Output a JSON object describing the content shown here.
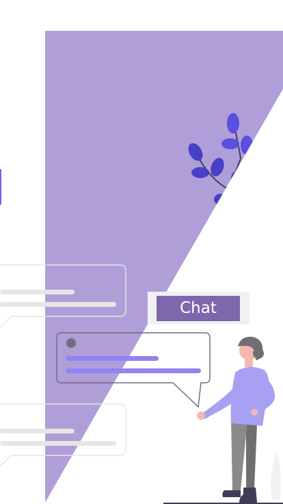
{
  "chat_button": {
    "label": "Chat"
  },
  "colors": {
    "accent_purple": "#b09ed8",
    "button_purple": "#7e67ad",
    "leaf_blue": "#5b4fe0",
    "person_shirt": "#a8a0f2",
    "person_pants": "#8a8a8c"
  },
  "illustration": {
    "name": "chat-conversation-illustration"
  }
}
